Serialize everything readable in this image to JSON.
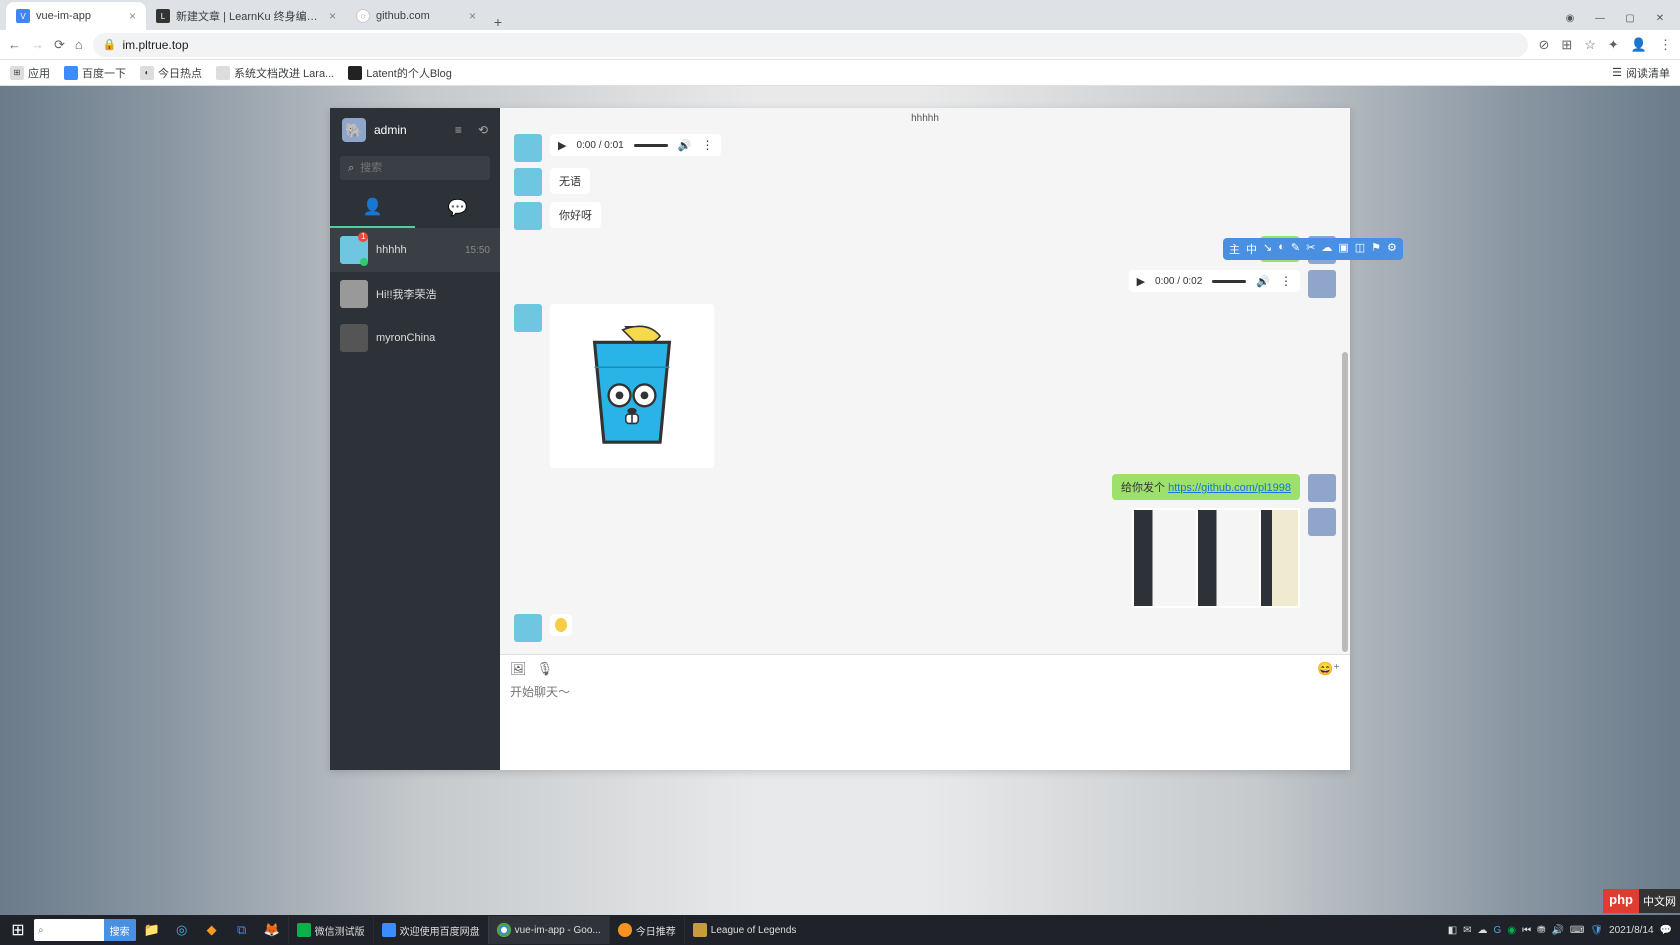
{
  "browser": {
    "tabs": [
      {
        "label": "vue-im-app",
        "active": true
      },
      {
        "label": "新建文章 | LearnKu 终身编程社",
        "active": false
      },
      {
        "label": "github.com",
        "active": false
      }
    ],
    "url": "im.pltrue.top",
    "bookmarks": [
      {
        "label": "应用"
      },
      {
        "label": "百度一下"
      },
      {
        "label": "今日热点"
      },
      {
        "label": "系统文档改进 Lara..."
      },
      {
        "label": "Latent的个人Blog"
      }
    ],
    "read_list": "阅读清单"
  },
  "sidebar": {
    "username": "admin",
    "search_placeholder": "搜索",
    "contacts": [
      {
        "name": "hhhhh",
        "time": "15:50",
        "badge": "1",
        "online": true
      },
      {
        "name": "Hi!!我李荣浩",
        "time": "",
        "badge": "",
        "online": false
      },
      {
        "name": "myronChina",
        "time": "",
        "badge": "",
        "online": false
      }
    ]
  },
  "chat": {
    "title": "hhhhh",
    "audio1": "0:00 / 0:01",
    "msg1": "无语",
    "msg2": "你好呀",
    "msg3": "你好",
    "audio2": "0:00 / 0:02",
    "msg4_prefix": "给你发个 ",
    "msg4_link": "https://github.com/pl1998",
    "input_placeholder": "开始聊天～"
  },
  "float_tools": [
    "主",
    "中",
    "↘",
    "◐",
    "✎",
    "✂",
    "☁",
    "▣",
    "◫",
    "⚑",
    "⚙"
  ],
  "taskbar": {
    "search_btn": "搜索",
    "apps": [
      {
        "label": "微信测试版",
        "icon": "wechat"
      },
      {
        "label": "欢迎使用百度网盘",
        "icon": "baidu"
      },
      {
        "label": "vue-im-app - Goo...",
        "icon": "chrome",
        "active": true
      },
      {
        "label": "今日推荐",
        "icon": "sun"
      },
      {
        "label": "League of Legends",
        "icon": "lol"
      }
    ],
    "date": "2021/8/14"
  },
  "wm": {
    "php": "php",
    "cn": "中文网"
  }
}
